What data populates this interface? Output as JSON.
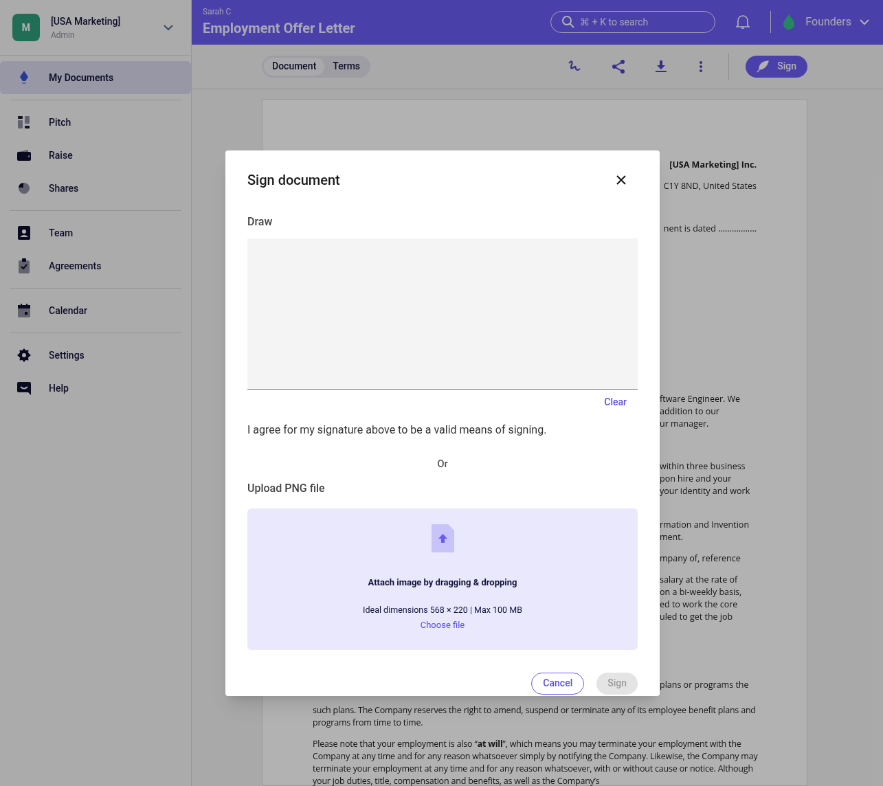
{
  "org": {
    "avatar": "M",
    "name": "[USA Marketing]",
    "role": "Admin"
  },
  "sidebar": {
    "groups": [
      [
        {
          "label": "My Documents",
          "kind": "pen",
          "selected": true
        }
      ],
      [
        {
          "label": "Pitch",
          "kind": "pitch",
          "selected": false
        },
        {
          "label": "Raise",
          "kind": "wallet",
          "selected": false
        },
        {
          "label": "Shares",
          "kind": "pie",
          "selected": false
        }
      ],
      [
        {
          "label": "Team",
          "kind": "badge",
          "selected": false
        },
        {
          "label": "Agreements",
          "kind": "clipboard",
          "selected": false
        }
      ],
      [
        {
          "label": "Calendar",
          "kind": "calendar",
          "selected": false
        }
      ],
      [
        {
          "label": "Settings",
          "kind": "gear",
          "selected": false
        },
        {
          "label": "Help",
          "kind": "chat",
          "selected": false
        }
      ]
    ]
  },
  "header": {
    "owner": "Sarah C",
    "title": "Employment Offer Letter",
    "search": {
      "placeholder": "⌘ + K to search"
    },
    "workspace": "Founders"
  },
  "toolbar": {
    "tabs": [
      {
        "label": "Document",
        "selected": true
      },
      {
        "label": "Terms",
        "selected": false
      }
    ],
    "sign_button": "Sign"
  },
  "document": {
    "top_lines": [
      "[USA Marketing] Inc.",
      "C1Y 8ND, United States",
      "nent is dated ................."
    ],
    "fragments": [
      [
        "ftware Engineer. We",
        "addition to our",
        "ur manager."
      ],
      [
        "within three business",
        "pon hire and your",
        "your identity and work"
      ],
      [
        "rmation and Invention",
        "ment."
      ],
      [
        "mpany of, reference"
      ],
      [
        "salary at the rate of",
        "on a bi-weekly basis,",
        "ed to work the core",
        "uled to get the job"
      ]
    ],
    "bottom_first": "plans or programs the",
    "paragraphs": [
      "such plans. The Company reserves the right to amend, suspend or terminate any of its employee benefit plans and programs from time to time.",
      "Please note that your employment is also “**at will**”, which means you may terminate your employment with the Company at any time and for any reason whatsoever simply by notifying the Company. Likewise, the Company may terminate your employment at any time and for any reason whatsoever, with or without cause or notice. Although your job duties, title, compensation and benefits, as well as the Company’s"
    ]
  },
  "modal": {
    "title": "Sign document",
    "draw_label": "Draw",
    "clear": "Clear",
    "agreement": "I agree for my signature above to be a valid means of signing.",
    "or": "Or",
    "upload_label": "Upload PNG file",
    "drop_title": "Attach image by dragging & dropping",
    "drop_hint": "Ideal dimensions 568 × 220 | Max 100 MB",
    "choose": "Choose file",
    "cancel": "Cancel",
    "sign": "Sign",
    "sign_disabled": true
  }
}
